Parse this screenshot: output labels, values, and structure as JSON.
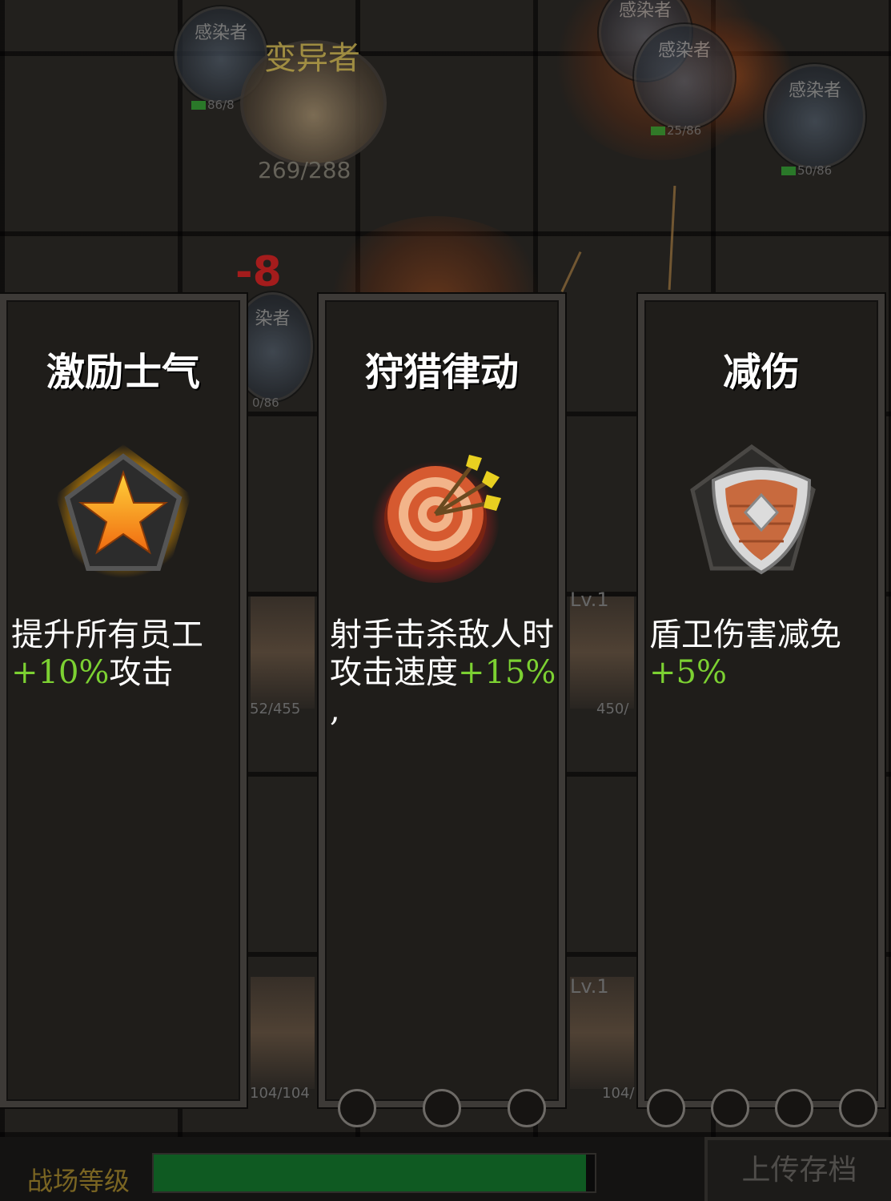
{
  "battlefield": {
    "boss": {
      "name": "变异者",
      "hp": "269/288"
    },
    "enemies": [
      {
        "name": "感染者",
        "hp": "86/8"
      },
      {
        "name": "感染者",
        "hp": ""
      },
      {
        "name": "感染者",
        "hp": "25/86"
      },
      {
        "name": "感染者",
        "hp": "50/86"
      },
      {
        "name": "染者",
        "hp": "0/86"
      }
    ],
    "damage_popup": "-8",
    "ally_labels": [
      "Lv.1",
      "Lv.1"
    ],
    "ally_hp": [
      "52/455",
      "450/",
      "104/104",
      "104/"
    ]
  },
  "cards": [
    {
      "title": "激励士气",
      "icon": "star-pentagon-icon",
      "desc_plain": "提升所有员工",
      "desc_green": "+10%",
      "desc_tail": "攻击"
    },
    {
      "title": "狩猎律动",
      "icon": "target-arrows-icon",
      "desc_plain": "射手击杀敌人时",
      "desc_mid": "攻击速度",
      "desc_green": "+15%",
      "desc_tail": ","
    },
    {
      "title": "减伤",
      "icon": "shield-icon",
      "desc_plain": "盾卫伤害减免",
      "desc_green": "+5%"
    }
  ],
  "footer": {
    "level_label": "战场等级",
    "level_progress": 0.98,
    "upload_label": "上传存档"
  },
  "colors": {
    "green_text": "#7cd132",
    "card_bg": "#1f1d1a",
    "level_fill": "#0f5a22"
  }
}
